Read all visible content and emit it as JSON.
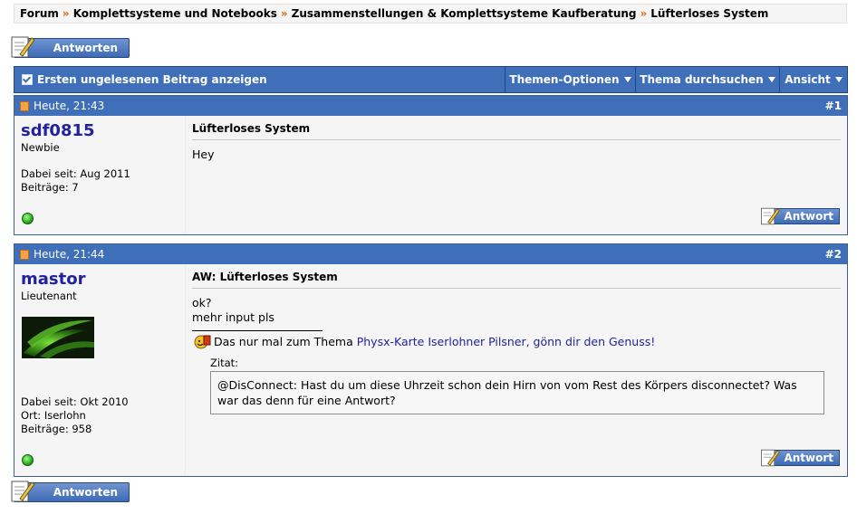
{
  "breadcrumb": {
    "items": [
      "Forum",
      "Komplettsysteme und Notebooks",
      "Zusammenstellungen & Komplettsysteme Kaufberatung",
      "Lüfterloses System"
    ],
    "separator": "»"
  },
  "reply_button_label": "Antworten",
  "toolbar": {
    "first_unread": "Ersten ungelesenen Beitrag anzeigen",
    "thread_options": "Themen-Optionen",
    "search_thread": "Thema durchsuchen",
    "view": "Ansicht"
  },
  "posts": [
    {
      "date": "Heute, 21:43",
      "number": "#1",
      "username": "sdf0815",
      "user_title": "Newbie",
      "stats": [
        "Dabei seit: Aug 2011",
        "Beiträge: 7"
      ],
      "title": "Lüfterloses System",
      "body": [
        "Hey"
      ],
      "reply_label": "Antwort"
    },
    {
      "date": "Heute, 21:44",
      "number": "#2",
      "username": "mastor",
      "user_title": "Lieutenant",
      "stats": [
        "Dabei seit: Okt 2010",
        "Ort: Iserlohn",
        "Beiträge: 958"
      ],
      "title": "AW: Lüfterloses System",
      "body": [
        "ok?",
        "mehr input pls"
      ],
      "signature_prefix": "Das nur mal zum Thema",
      "signature_link": "Physx-Karte Iserlohner Pilsner, gönn dir den Genuss!",
      "quote_label": "Zitat:",
      "quote_text": "@DisConnect: Hast du um diese Uhrzeit schon dein Hirn von vom Rest des Körpers disconnectet? Was war das denn für eine Antwort?",
      "reply_label": "Antwort"
    }
  ],
  "colors": {
    "header_blue": "#3f6fb8",
    "breadcrumb_separator": "#e26a0e",
    "username": "#22229c"
  }
}
